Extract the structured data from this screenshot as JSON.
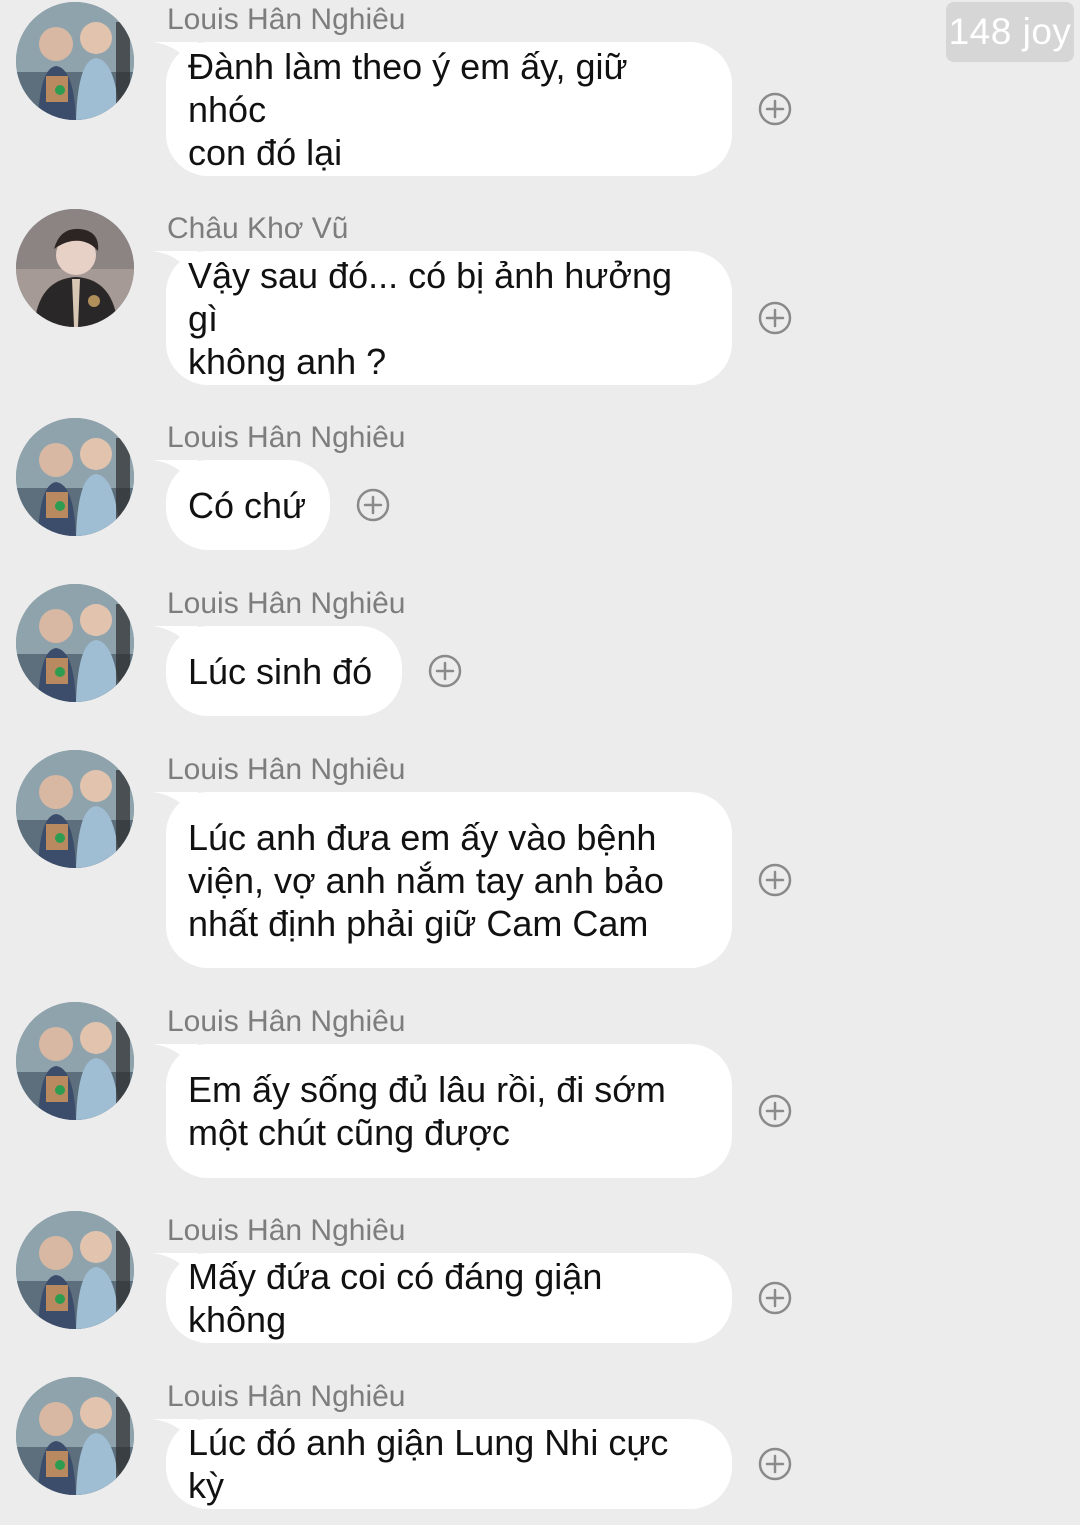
{
  "watermark": "148 joy",
  "icons": {
    "avatar_louis": "avatar-louis-han-nghieu",
    "avatar_chau": "avatar-chau-kho-vu",
    "reaction": "add-reaction-circle-plus-icon"
  },
  "colors": {
    "background": "#ececec",
    "bubble": "#ffffff",
    "sender_name": "#7d7d7d",
    "message_text": "#111111",
    "reaction_icon": "#8a8a8a"
  },
  "messages": [
    {
      "sender": "Louis Hân Nghiêu",
      "text": "Đành làm theo ý em ấy, giữ nhóc\ncon đó lại"
    },
    {
      "sender": "Châu Khơ Vũ",
      "text": "Vậy sau đó... có bị ảnh hưởng gì\nkhông anh ?"
    },
    {
      "sender": "Louis Hân Nghiêu",
      "text": "Có chứ"
    },
    {
      "sender": "Louis Hân Nghiêu",
      "text": "Lúc sinh đó"
    },
    {
      "sender": "Louis Hân Nghiêu",
      "text": "Lúc anh đưa em ấy vào bệnh\nviện, vợ anh nắm tay anh bảo\nnhất định phải giữ Cam Cam"
    },
    {
      "sender": "Louis Hân Nghiêu",
      "text": "Em ấy sống đủ lâu rồi, đi sớm\nmột chút cũng được"
    },
    {
      "sender": "Louis Hân Nghiêu",
      "text": "Mấy đứa coi có đáng giận không"
    },
    {
      "sender": "Louis Hân Nghiêu",
      "text": "Lúc đó anh giận Lung Nhi cực kỳ"
    }
  ]
}
